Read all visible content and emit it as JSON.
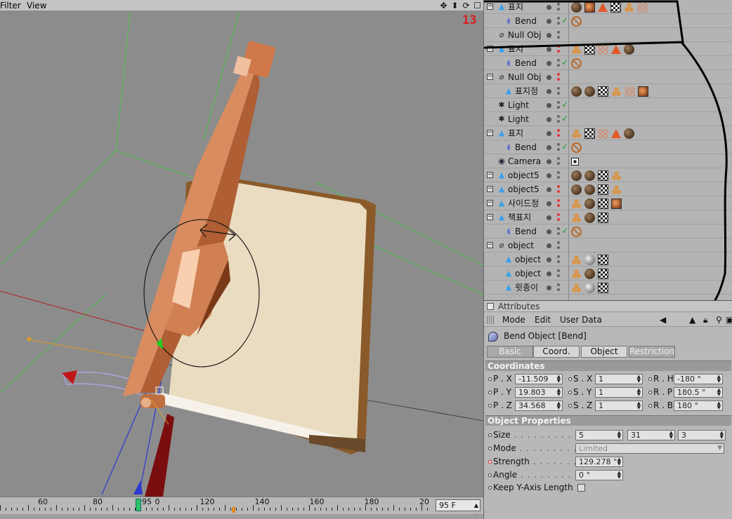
{
  "viewport": {
    "menu": [
      "Filter",
      "View"
    ],
    "number_label": "13",
    "nav_icons": [
      "move-icon",
      "pan-icon",
      "rotate-icon",
      "maximize-icon"
    ]
  },
  "timeline": {
    "labels": [
      "60",
      "80",
      "95",
      "0",
      "120",
      "140",
      "160",
      "180",
      "20"
    ],
    "current_frame": "95 F"
  },
  "object_manager": {
    "rows": [
      {
        "name": "표지",
        "type": "poly",
        "tags": [
          "sphere",
          "tex",
          "tri",
          "check",
          "balls",
          "rings"
        ]
      },
      {
        "name": "Bend",
        "type": "bend",
        "tags": [
          "bend"
        ]
      },
      {
        "name": "Null Obj",
        "type": "null",
        "tags": []
      },
      {
        "name": "표지",
        "type": "poly",
        "tags": [
          "balls",
          "check",
          "rings",
          "tri",
          "sphere"
        ]
      },
      {
        "name": "Bend",
        "type": "bend",
        "tags": [
          "bend"
        ]
      },
      {
        "name": "Null Obj",
        "type": "null",
        "tags": []
      },
      {
        "name": "표지정",
        "type": "poly",
        "tags": [
          "sphere",
          "sphere",
          "check",
          "balls",
          "rings",
          "tex"
        ]
      },
      {
        "name": "Light",
        "type": "light",
        "tags": []
      },
      {
        "name": "Light",
        "type": "light",
        "tags": []
      },
      {
        "name": "표지",
        "type": "poly",
        "tags": [
          "balls",
          "check",
          "rings",
          "tri",
          "sphere"
        ]
      },
      {
        "name": "Bend",
        "type": "bend",
        "tags": [
          "bend"
        ]
      },
      {
        "name": "Camera",
        "type": "camera",
        "tags": [
          "camtag"
        ]
      },
      {
        "name": "object5",
        "type": "poly",
        "tags": [
          "sphere",
          "sphere",
          "check",
          "balls"
        ]
      },
      {
        "name": "object5",
        "type": "poly",
        "tags": [
          "sphere",
          "sphere",
          "check",
          "balls"
        ]
      },
      {
        "name": "사이드정",
        "type": "poly",
        "tags": [
          "balls",
          "sphere",
          "check",
          "tex"
        ]
      },
      {
        "name": "책표지",
        "type": "poly",
        "tags": [
          "balls",
          "sphere",
          "check"
        ]
      },
      {
        "name": "Bend",
        "type": "bend",
        "tags": [
          "bend"
        ]
      },
      {
        "name": "object",
        "type": "null",
        "tags": []
      },
      {
        "name": "object",
        "type": "poly",
        "tags": [
          "balls",
          "grey",
          "check"
        ]
      },
      {
        "name": "object",
        "type": "poly",
        "tags": [
          "balls",
          "sphere",
          "check"
        ]
      },
      {
        "name": "윗종이",
        "type": "poly",
        "tags": [
          "balls",
          "grey",
          "check"
        ]
      }
    ]
  },
  "attributes": {
    "title": "Attributes",
    "menu": [
      "Mode",
      "Edit",
      "User Data"
    ],
    "object_title": "Bend Object [Bend]",
    "tabs": [
      "Basic",
      "Coord.",
      "Object",
      "Restriction"
    ],
    "coordinates_header": "Coordinates",
    "coords": [
      {
        "p_label": "P . X",
        "p_val": "-11.509",
        "s_label": "S . X",
        "s_val": "1",
        "r_label": "R . H",
        "r_val": "-180 °"
      },
      {
        "p_label": "P . Y",
        "p_val": "19.803",
        "s_label": "S . Y",
        "s_val": "1",
        "r_label": "R . P",
        "r_val": "180.5 °"
      },
      {
        "p_label": "P . Z",
        "p_val": "34.568",
        "s_label": "S . Z",
        "s_val": "1",
        "r_label": "R . B",
        "r_val": "180 °"
      }
    ],
    "object_properties_header": "Object Properties",
    "size_label": "Size",
    "size_values": [
      "5",
      "31",
      "3"
    ],
    "mode_label": "Mode",
    "mode_value": "Limited",
    "strength_label": "Strength",
    "strength_value": "129.278 °",
    "angle_label": "Angle",
    "angle_value": "0 °",
    "keep_label": "Keep Y-Axis Length"
  },
  "colors": {
    "accent_red": "#d81e1e",
    "book_copper": "#c8744a",
    "paper": "#eadcc0"
  }
}
